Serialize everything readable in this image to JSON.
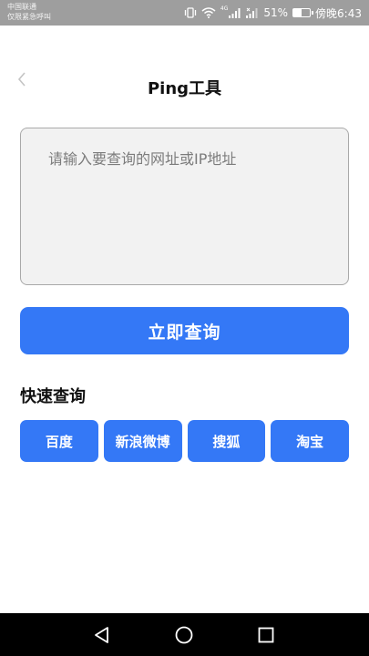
{
  "status_bar": {
    "carrier_line1": "中国联通",
    "carrier_line2": "仅限紧急呼叫",
    "network_label": "4G",
    "battery_percent": "51%",
    "battery_level": 0.51,
    "time": "傍晚6:43"
  },
  "header": {
    "back_icon": "chevron-left-icon",
    "title": "Ping工具"
  },
  "query": {
    "placeholder": "请输入要查询的网址或IP地址",
    "value": "",
    "button_label": "立即查询"
  },
  "quick": {
    "title": "快速查询",
    "items": [
      {
        "label": "百度"
      },
      {
        "label": "新浪微博"
      },
      {
        "label": "搜狐"
      },
      {
        "label": "淘宝"
      }
    ]
  },
  "nav_bar": {
    "back": "triangle-back-icon",
    "home": "circle-home-icon",
    "recents": "square-recents-icon"
  },
  "colors": {
    "accent": "#3478f6",
    "status_bar": "#9e9e9e",
    "input_bg": "#f2f2f2"
  }
}
